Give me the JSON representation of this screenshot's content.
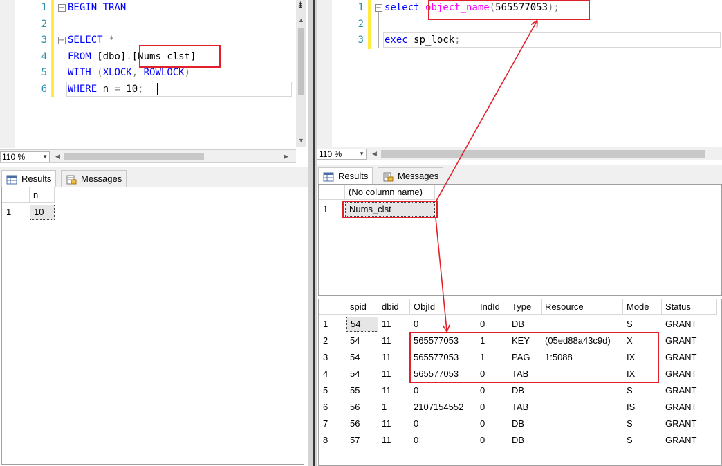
{
  "left": {
    "editor": {
      "lines": [
        {
          "n": "1",
          "fold": "−",
          "parts": [
            {
              "c": "kw",
              "t": "BEGIN TRAN"
            }
          ]
        },
        {
          "n": "2",
          "fold": "",
          "parts": []
        },
        {
          "n": "3",
          "fold": "−",
          "parts": [
            {
              "c": "kw",
              "t": "SELECT "
            },
            {
              "c": "gy",
              "t": "*"
            }
          ]
        },
        {
          "n": "4",
          "fold": "",
          "parts": [
            {
              "c": "kw",
              "t": "FROM "
            },
            {
              "c": "tx",
              "t": "[dbo]"
            },
            {
              "c": "gy",
              "t": "."
            },
            {
              "c": "tx",
              "t": "[Nums_clst]"
            }
          ]
        },
        {
          "n": "5",
          "fold": "",
          "parts": [
            {
              "c": "kw",
              "t": "WITH "
            },
            {
              "c": "gy",
              "t": "("
            },
            {
              "c": "kw",
              "t": "XLOCK"
            },
            {
              "c": "gy",
              "t": ", "
            },
            {
              "c": "kw",
              "t": "ROWLOCK"
            },
            {
              "c": "gy",
              "t": ")"
            }
          ]
        },
        {
          "n": "6",
          "fold": "",
          "parts": [
            {
              "c": "kw",
              "t": "WHERE "
            },
            {
              "c": "tx",
              "t": "n "
            },
            {
              "c": "gy",
              "t": "= "
            },
            {
              "c": "tx",
              "t": "10"
            },
            {
              "c": "gy",
              "t": ";"
            }
          ]
        }
      ]
    },
    "zoom": "110 %",
    "tabs": {
      "results": "Results",
      "messages": "Messages"
    },
    "grid": {
      "columns": [
        "n"
      ],
      "rows": [
        {
          "num": "1",
          "cells": [
            "10"
          ]
        }
      ]
    }
  },
  "right": {
    "editor": {
      "lines": [
        {
          "n": "1",
          "fold": "−",
          "parts": [
            {
              "c": "kw",
              "t": "select "
            },
            {
              "c": "fn",
              "t": "object_name"
            },
            {
              "c": "gy",
              "t": "("
            },
            {
              "c": "tx",
              "t": "565577053"
            },
            {
              "c": "gy",
              "t": ");"
            }
          ]
        },
        {
          "n": "2",
          "fold": "",
          "parts": []
        },
        {
          "n": "3",
          "fold": "",
          "parts": [
            {
              "c": "kw",
              "t": "exec "
            },
            {
              "c": "tx",
              "t": "sp_lock"
            },
            {
              "c": "gy",
              "t": ";"
            }
          ]
        }
      ]
    },
    "zoom": "110 %",
    "tabs": {
      "results": "Results",
      "messages": "Messages"
    },
    "grid1": {
      "columns": [
        "(No column name)"
      ],
      "rows": [
        {
          "num": "1",
          "cells": [
            "Nums_clst"
          ]
        }
      ]
    },
    "grid2": {
      "columns": [
        "spid",
        "dbid",
        "ObjId",
        "IndId",
        "Type",
        "Resource",
        "Mode",
        "Status"
      ],
      "rows": [
        {
          "num": "1",
          "cells": [
            "54",
            "11",
            "0",
            "0",
            "DB",
            "",
            "S",
            "GRANT"
          ]
        },
        {
          "num": "2",
          "cells": [
            "54",
            "11",
            "565577053",
            "1",
            "KEY",
            "(05ed88a43c9d)",
            "X",
            "GRANT"
          ]
        },
        {
          "num": "3",
          "cells": [
            "54",
            "11",
            "565577053",
            "1",
            "PAG",
            "1:5088",
            "IX",
            "GRANT"
          ]
        },
        {
          "num": "4",
          "cells": [
            "54",
            "11",
            "565577053",
            "0",
            "TAB",
            "",
            "IX",
            "GRANT"
          ]
        },
        {
          "num": "5",
          "cells": [
            "55",
            "11",
            "0",
            "0",
            "DB",
            "",
            "S",
            "GRANT"
          ]
        },
        {
          "num": "6",
          "cells": [
            "56",
            "1",
            "2107154552",
            "0",
            "TAB",
            "",
            "IS",
            "GRANT"
          ]
        },
        {
          "num": "7",
          "cells": [
            "56",
            "11",
            "0",
            "0",
            "DB",
            "",
            "S",
            "GRANT"
          ]
        },
        {
          "num": "8",
          "cells": [
            "57",
            "11",
            "0",
            "0",
            "DB",
            "",
            "S",
            "GRANT"
          ]
        }
      ]
    }
  },
  "colors": {
    "highlight": "#e0202a",
    "keyword": "#0000ff",
    "function": "#ff00ff",
    "line_number": "#2b91af"
  }
}
